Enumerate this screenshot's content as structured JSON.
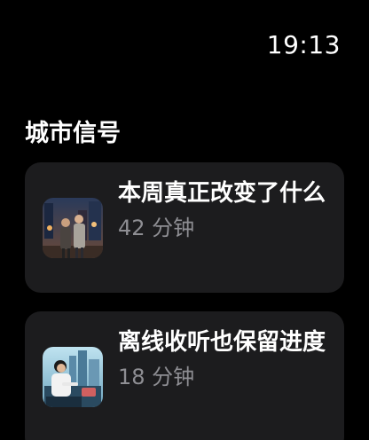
{
  "status": {
    "time": "19:13"
  },
  "section": {
    "title": "城市信号"
  },
  "episodes": [
    {
      "title": "本周真正改变了什么",
      "duration": "42 分钟",
      "thumbnail": "couple-city-night-icon"
    },
    {
      "title": "离线收听也保留进度",
      "duration": "18 分钟",
      "thumbnail": "person-city-view-icon"
    }
  ],
  "colors": {
    "background": "#000000",
    "card": "#1c1c1e",
    "secondary_text": "#8e8e93"
  }
}
